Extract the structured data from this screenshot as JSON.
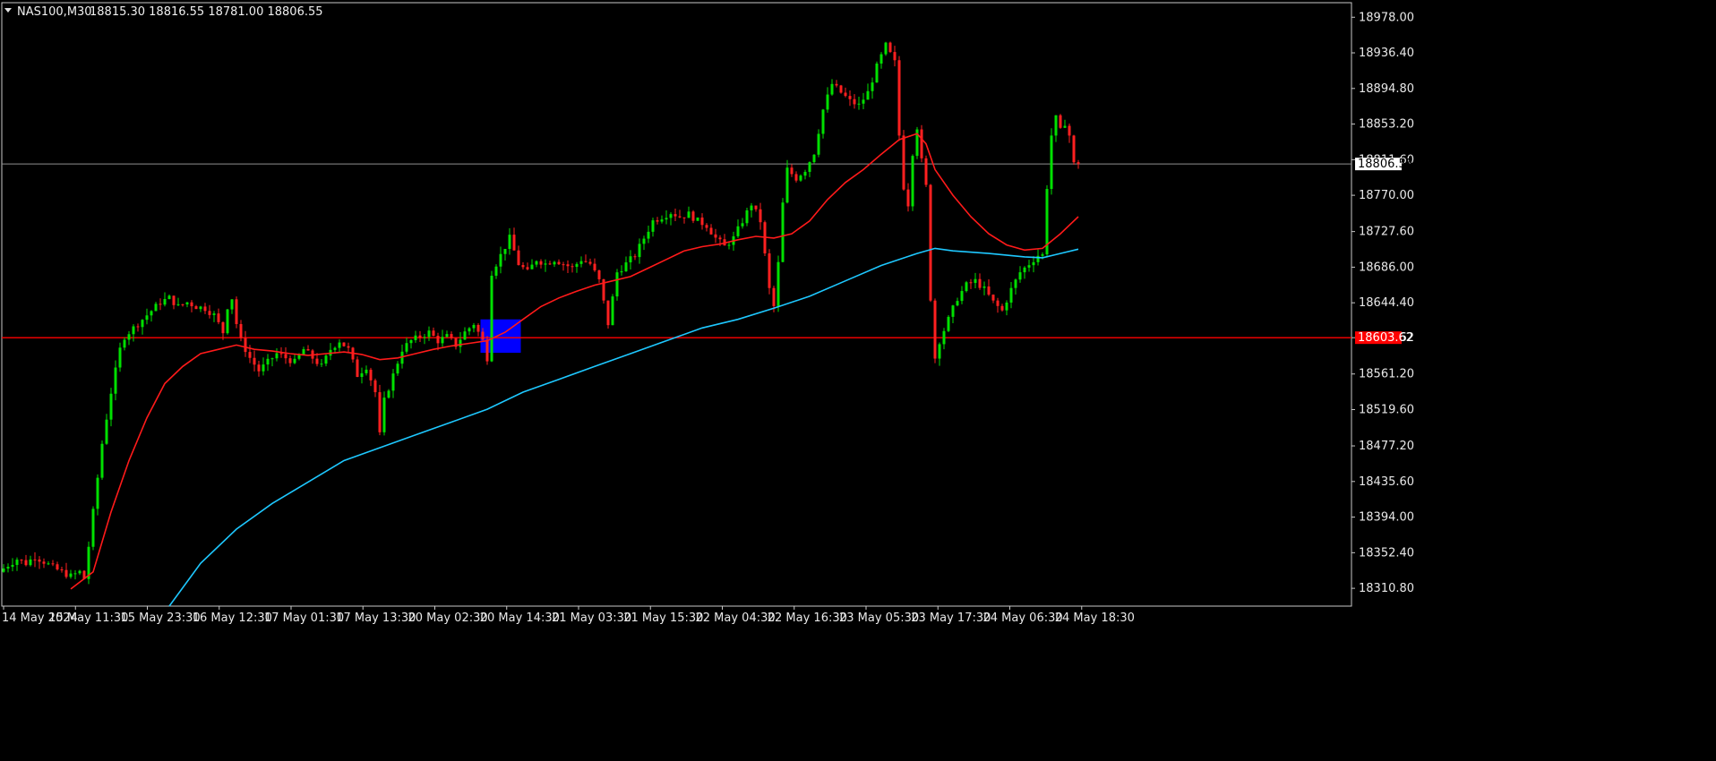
{
  "header": {
    "symbol_timeframe": "NAS100,M30",
    "ohlc": "18815.30 18816.55 18781.00 18806.55"
  },
  "colors": {
    "background": "#000000",
    "frame": "#c8c8c8",
    "bull_candle": "#00e000",
    "bear_candle": "#ff2020",
    "ma_fast": "#ff1a1a",
    "ma_slow": "#1ec8ff",
    "bid_line": "#909090",
    "level_line": "#ff0000",
    "zone_fill": "#0000ff"
  },
  "chart_data": {
    "type": "candlestick",
    "symbol": "NAS100",
    "timeframe": "M30",
    "ylim": [
      18290.0,
      18995.0
    ],
    "y_ticks": [
      "18978.00",
      "18936.40",
      "18894.80",
      "18853.20",
      "18811.60",
      "18770.00",
      "18727.60",
      "18686.00",
      "18644.40",
      "18603.62",
      "18561.20",
      "18519.60",
      "18477.20",
      "18435.60",
      "18394.00",
      "18352.40",
      "18310.80"
    ],
    "x_ticks": [
      "14 May 2024",
      "15 May 11:30",
      "15 May 23:30",
      "16 May 12:30",
      "17 May 01:30",
      "17 May 13:30",
      "20 May 02:30",
      "20 May 14:30",
      "21 May 03:30",
      "21 May 15:30",
      "22 May 04:30",
      "22 May 16:30",
      "23 May 05:30",
      "23 May 17:30",
      "24 May 06:30",
      "24 May 18:30"
    ],
    "price_path": [
      [
        0,
        18330
      ],
      [
        2,
        18338
      ],
      [
        4,
        18345
      ],
      [
        6,
        18340
      ],
      [
        8,
        18348
      ],
      [
        10,
        18342
      ],
      [
        12,
        18335
      ],
      [
        14,
        18330
      ],
      [
        16,
        18325
      ],
      [
        18,
        18330
      ],
      [
        19,
        18322
      ],
      [
        20,
        18360
      ],
      [
        20.5,
        18420
      ],
      [
        21,
        18400
      ],
      [
        22,
        18440
      ],
      [
        23,
        18480
      ],
      [
        24,
        18510
      ],
      [
        25,
        18540
      ],
      [
        26,
        18565
      ],
      [
        27,
        18590
      ],
      [
        28,
        18605
      ],
      [
        30,
        18615
      ],
      [
        32,
        18625
      ],
      [
        34,
        18635
      ],
      [
        36,
        18645
      ],
      [
        38,
        18650
      ],
      [
        40,
        18640
      ],
      [
        42,
        18645
      ],
      [
        44,
        18640
      ],
      [
        46,
        18638
      ],
      [
        48,
        18630
      ],
      [
        50,
        18610
      ],
      [
        51,
        18640
      ],
      [
        52,
        18650
      ],
      [
        53,
        18620
      ],
      [
        54,
        18600
      ],
      [
        56,
        18580
      ],
      [
        58,
        18565
      ],
      [
        60,
        18575
      ],
      [
        62,
        18585
      ],
      [
        64,
        18580
      ],
      [
        66,
        18575
      ],
      [
        68,
        18590
      ],
      [
        70,
        18580
      ],
      [
        72,
        18570
      ],
      [
        74,
        18590
      ],
      [
        76,
        18600
      ],
      [
        78,
        18590
      ],
      [
        80,
        18560
      ],
      [
        82,
        18570
      ],
      [
        84,
        18540
      ],
      [
        85,
        18490
      ],
      [
        86,
        18530
      ],
      [
        88,
        18560
      ],
      [
        90,
        18590
      ],
      [
        92,
        18600
      ],
      [
        94,
        18605
      ],
      [
        96,
        18610
      ],
      [
        98,
        18600
      ],
      [
        100,
        18605
      ],
      [
        102,
        18595
      ],
      [
        104,
        18610
      ],
      [
        106,
        18620
      ],
      [
        108,
        18600
      ],
      [
        109,
        18580
      ],
      [
        110,
        18680
      ],
      [
        112,
        18700
      ],
      [
        114,
        18720
      ],
      [
        116,
        18690
      ],
      [
        118,
        18680
      ],
      [
        120,
        18695
      ],
      [
        122,
        18690
      ],
      [
        124,
        18695
      ],
      [
        126,
        18690
      ],
      [
        128,
        18685
      ],
      [
        130,
        18695
      ],
      [
        132,
        18690
      ],
      [
        134,
        18670
      ],
      [
        136,
        18620
      ],
      [
        138,
        18680
      ],
      [
        140,
        18690
      ],
      [
        142,
        18700
      ],
      [
        144,
        18720
      ],
      [
        146,
        18740
      ],
      [
        148,
        18745
      ],
      [
        150,
        18750
      ],
      [
        152,
        18745
      ],
      [
        154,
        18748
      ],
      [
        156,
        18740
      ],
      [
        158,
        18735
      ],
      [
        160,
        18720
      ],
      [
        162,
        18710
      ],
      [
        164,
        18720
      ],
      [
        166,
        18740
      ],
      [
        168,
        18760
      ],
      [
        170,
        18740
      ],
      [
        171,
        18700
      ],
      [
        172,
        18660
      ],
      [
        173,
        18640
      ],
      [
        174,
        18690
      ],
      [
        175,
        18760
      ],
      [
        176,
        18800
      ],
      [
        178,
        18790
      ],
      [
        180,
        18800
      ],
      [
        182,
        18820
      ],
      [
        184,
        18870
      ],
      [
        186,
        18900
      ],
      [
        188,
        18890
      ],
      [
        190,
        18880
      ],
      [
        192,
        18875
      ],
      [
        194,
        18890
      ],
      [
        196,
        18920
      ],
      [
        198,
        18945
      ],
      [
        200,
        18925
      ],
      [
        201,
        18840
      ],
      [
        202,
        18780
      ],
      [
        203,
        18760
      ],
      [
        204,
        18820
      ],
      [
        205,
        18850
      ],
      [
        206,
        18810
      ],
      [
        207,
        18780
      ],
      [
        208,
        18650
      ],
      [
        209,
        18580
      ],
      [
        210,
        18600
      ],
      [
        212,
        18625
      ],
      [
        214,
        18650
      ],
      [
        216,
        18665
      ],
      [
        218,
        18670
      ],
      [
        220,
        18660
      ],
      [
        222,
        18645
      ],
      [
        224,
        18635
      ],
      [
        226,
        18660
      ],
      [
        228,
        18680
      ],
      [
        230,
        18690
      ],
      [
        232,
        18700
      ],
      [
        233,
        18700
      ],
      [
        234,
        18780
      ],
      [
        235,
        18840
      ],
      [
        236,
        18860
      ],
      [
        237,
        18845
      ],
      [
        238,
        18855
      ],
      [
        239,
        18840
      ],
      [
        240,
        18806.55
      ]
    ],
    "indicators": [
      {
        "type": "moving_average",
        "points": [
          [
            15,
            18310
          ],
          [
            20,
            18330
          ],
          [
            24,
            18400
          ],
          [
            28,
            18460
          ],
          [
            32,
            18510
          ],
          [
            36,
            18550
          ],
          [
            40,
            18570
          ],
          [
            44,
            18585
          ],
          [
            48,
            18590
          ],
          [
            52,
            18595
          ],
          [
            56,
            18590
          ],
          [
            60,
            18588
          ],
          [
            64,
            18585
          ],
          [
            68,
            18583
          ],
          [
            72,
            18585
          ],
          [
            76,
            18587
          ],
          [
            80,
            18584
          ],
          [
            84,
            18578
          ],
          [
            88,
            18580
          ],
          [
            92,
            18585
          ],
          [
            96,
            18590
          ],
          [
            100,
            18594
          ],
          [
            104,
            18597
          ],
          [
            108,
            18600
          ],
          [
            112,
            18610
          ],
          [
            116,
            18625
          ],
          [
            120,
            18640
          ],
          [
            124,
            18650
          ],
          [
            128,
            18658
          ],
          [
            132,
            18665
          ],
          [
            136,
            18670
          ],
          [
            140,
            18675
          ],
          [
            144,
            18685
          ],
          [
            148,
            18695
          ],
          [
            152,
            18705
          ],
          [
            156,
            18710
          ],
          [
            160,
            18713
          ],
          [
            164,
            18718
          ],
          [
            168,
            18722
          ],
          [
            172,
            18720
          ],
          [
            176,
            18725
          ],
          [
            180,
            18740
          ],
          [
            184,
            18765
          ],
          [
            188,
            18785
          ],
          [
            192,
            18800
          ],
          [
            196,
            18818
          ],
          [
            200,
            18835
          ],
          [
            204,
            18842
          ],
          [
            206,
            18830
          ],
          [
            208,
            18800
          ],
          [
            212,
            18770
          ],
          [
            216,
            18745
          ],
          [
            220,
            18725
          ],
          [
            224,
            18712
          ],
          [
            228,
            18706
          ],
          [
            232,
            18708
          ],
          [
            236,
            18725
          ],
          [
            240,
            18745
          ]
        ]
      },
      {
        "type": "moving_average",
        "points": [
          [
            37,
            18290
          ],
          [
            44,
            18340
          ],
          [
            52,
            18380
          ],
          [
            60,
            18410
          ],
          [
            68,
            18435
          ],
          [
            76,
            18460
          ],
          [
            84,
            18475
          ],
          [
            92,
            18490
          ],
          [
            100,
            18505
          ],
          [
            108,
            18520
          ],
          [
            116,
            18540
          ],
          [
            124,
            18555
          ],
          [
            132,
            18570
          ],
          [
            140,
            18585
          ],
          [
            148,
            18600
          ],
          [
            156,
            18615
          ],
          [
            164,
            18625
          ],
          [
            172,
            18638
          ],
          [
            180,
            18652
          ],
          [
            188,
            18670
          ],
          [
            196,
            18688
          ],
          [
            204,
            18702
          ],
          [
            208,
            18708
          ],
          [
            212,
            18705
          ],
          [
            220,
            18702
          ],
          [
            228,
            18698
          ],
          [
            232,
            18697
          ],
          [
            236,
            18702
          ],
          [
            240,
            18707
          ]
        ]
      }
    ],
    "horizontal_lines": [
      {
        "price": 18806.55,
        "label": "18806.55",
        "style": "bid"
      },
      {
        "price": 18603.62,
        "label": "18603.62",
        "style": "level"
      }
    ],
    "rectangles": [
      {
        "x0": 106.5,
        "x1": 115.5,
        "y0": 18586,
        "y1": 18625
      }
    ]
  }
}
